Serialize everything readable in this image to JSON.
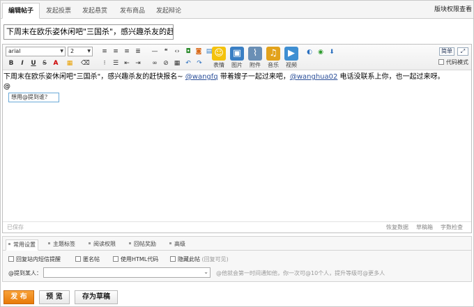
{
  "tabs": [
    {
      "label": "编辑帖子",
      "active": true
    },
    {
      "label": "发起投票",
      "active": false
    },
    {
      "label": "发起悬赏",
      "active": false
    },
    {
      "label": "发布商品",
      "active": false
    },
    {
      "label": "发起辩论",
      "active": false
    }
  ],
  "tab_right": "版块权限查看",
  "subject": "下周末在欧乐姿休闲吧\"三国杀\"，感兴趣杀友的赶快报名~",
  "toolbar": {
    "font": "arial",
    "size": "2",
    "simple_label": "简单",
    "code_mode_label": "代码模式",
    "big_buttons": [
      {
        "label": "表情",
        "icon": "smiley-icon",
        "glyph": "☺",
        "color": "#f4c20d"
      },
      {
        "label": "图片",
        "icon": "image-icon",
        "glyph": "▣",
        "color": "#3a7fc4"
      },
      {
        "label": "附件",
        "icon": "paperclip-icon",
        "glyph": "⌇",
        "color": "#6a8fb5"
      },
      {
        "label": "音乐",
        "icon": "music-icon",
        "glyph": "♫",
        "color": "#e2a21c"
      },
      {
        "label": "视频",
        "icon": "video-icon",
        "glyph": "▶",
        "color": "#3f8fd2"
      }
    ]
  },
  "content": {
    "line1_before": "下周末在欧乐姿休闲吧\"三国杀\"，感兴趣杀友的赶快报名~ ",
    "mention1": "@wangfq",
    "line1_middle": " 带着嫂子一起过来吧，",
    "mention2": "@wanghua02",
    "line1_after": " 电话没联系上你，也一起过来呀。",
    "line2": "@",
    "popup": "想用@提到谁？"
  },
  "status": {
    "saved": "已保存",
    "restore": "恢复数据",
    "draft_box": "草稿箱",
    "word_check": "字数检查"
  },
  "options": {
    "tabs": [
      "常用设置",
      "主题标签",
      "阅读权限",
      "回帖奖励",
      "高级"
    ],
    "checkboxes": [
      {
        "label": "回复站内短信提醒",
        "extra": ""
      },
      {
        "label": "匿名帖",
        "extra": ""
      },
      {
        "label": "使用HTML代码",
        "extra": ""
      },
      {
        "label": "隐藏此帖",
        "extra": "(回复可见)"
      }
    ],
    "at_label": "@提到某人：",
    "at_value": "",
    "at_hint": "@他就会第一时间通知他，你一次可@10个人，提升等级可@更多人"
  },
  "buttons": {
    "publish": "发 布",
    "preview": "预 览",
    "save_draft": "存为草稿"
  }
}
